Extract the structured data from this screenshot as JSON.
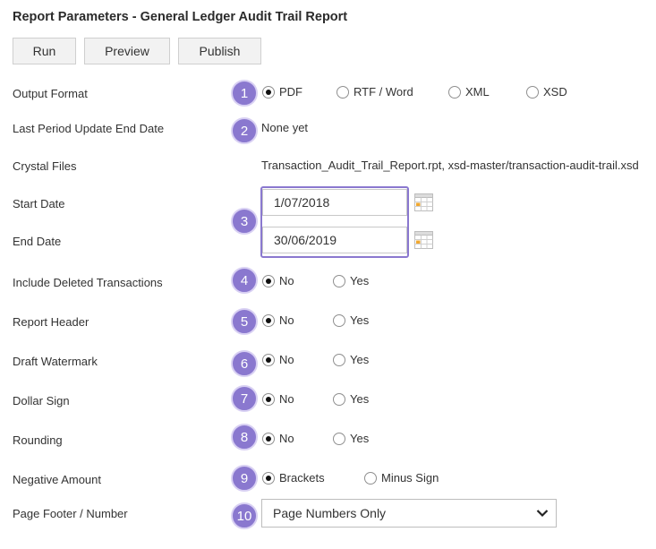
{
  "title": "Report Parameters - General Ledger Audit Trail Report",
  "toolbar": {
    "run_label": "Run",
    "preview_label": "Preview",
    "publish_label": "Publish"
  },
  "fields": {
    "output_format": {
      "label": "Output Format",
      "badge": "1",
      "options": [
        "PDF",
        "RTF / Word",
        "XML",
        "XSD"
      ],
      "selected": "PDF"
    },
    "last_period": {
      "label": "Last Period Update End Date",
      "badge": "2",
      "value": "None yet"
    },
    "crystal_files": {
      "label": "Crystal Files",
      "value": "Transaction_Audit_Trail_Report.rpt, xsd-master/transaction-audit-trail.xsd"
    },
    "dates_badge": "3",
    "start_date": {
      "label": "Start Date",
      "value": "1/07/2018"
    },
    "end_date": {
      "label": "End Date",
      "value": "30/06/2019"
    },
    "include_deleted": {
      "label": "Include Deleted Transactions",
      "badge": "4",
      "options": [
        "No",
        "Yes"
      ],
      "selected": "No"
    },
    "report_header": {
      "label": "Report Header",
      "badge": "5",
      "options": [
        "No",
        "Yes"
      ],
      "selected": "No"
    },
    "draft_watermark": {
      "label": "Draft Watermark",
      "badge": "6",
      "options": [
        "No",
        "Yes"
      ],
      "selected": "No"
    },
    "dollar_sign": {
      "label": "Dollar Sign",
      "badge": "7",
      "options": [
        "No",
        "Yes"
      ],
      "selected": "No"
    },
    "rounding": {
      "label": "Rounding",
      "badge": "8",
      "options": [
        "No",
        "Yes"
      ],
      "selected": "No"
    },
    "negative_amount": {
      "label": "Negative Amount",
      "badge": "9",
      "options": [
        "Brackets",
        "Minus Sign"
      ],
      "selected": "Brackets"
    },
    "page_footer": {
      "label": "Page Footer / Number",
      "badge": "10",
      "value": "Page Numbers Only"
    }
  },
  "colors": {
    "badge": "#8a78cf",
    "highlight_border": "#8a78cf"
  },
  "icons": {
    "calendar": "calendar-icon",
    "dropdown": "chevron-down-icon"
  }
}
